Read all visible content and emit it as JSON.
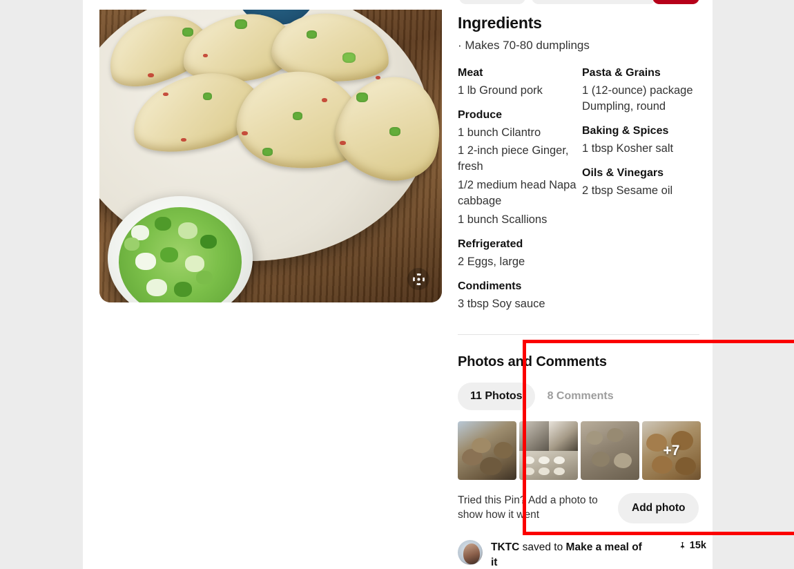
{
  "topbar": {
    "pill_one_label": "",
    "pill_two_label": "",
    "save_button_label": "",
    "accent_red": "#b60019"
  },
  "hero": {
    "alt": "Dumplings on a white plate with a bowl of chopped scallions on a wooden table",
    "visual_search_icon": "target-crosshair-icon"
  },
  "ingredients": {
    "title": "Ingredients",
    "servings": "· Makes 70-80 dumplings",
    "columns": [
      {
        "groups": [
          {
            "name": "Meat",
            "items": [
              "1 lb Ground pork"
            ]
          },
          {
            "name": "Produce",
            "items": [
              "1 bunch Cilantro",
              "1 2-inch piece Ginger, fresh",
              "1/2 medium head Napa cabbage",
              "1 bunch Scallions"
            ]
          },
          {
            "name": "Refrigerated",
            "items": [
              "2 Eggs, large"
            ]
          },
          {
            "name": "Condiments",
            "items": [
              "3 tbsp Soy sauce"
            ]
          }
        ]
      },
      {
        "groups": [
          {
            "name": "Pasta & Grains",
            "items": [
              "1 (12-ounce) package Dumpling, round"
            ]
          },
          {
            "name": "Baking & Spices",
            "items": [
              "1 tbsp Kosher salt"
            ]
          },
          {
            "name": "Oils & Vinegars",
            "items": [
              "2 tbsp Sesame oil"
            ]
          }
        ]
      }
    ]
  },
  "photos_and_comments": {
    "title": "Photos and Comments",
    "tabs": [
      {
        "label": "11 Photos",
        "active": true
      },
      {
        "label": "8 Comments",
        "active": false
      }
    ],
    "thumbnails": [
      {
        "name": "photo-thumbnail-1",
        "overlay": ""
      },
      {
        "name": "photo-thumbnail-2",
        "overlay": ""
      },
      {
        "name": "photo-thumbnail-3",
        "overlay": ""
      },
      {
        "name": "photo-thumbnail-4",
        "overlay": "+7"
      }
    ],
    "cta_text": "Tried this Pin? Add a photo to show how it went",
    "cta_button": "Add photo",
    "highlight_color": "#fb0000"
  },
  "saver": {
    "name": "TKTC",
    "action": " saved to ",
    "board": "Make a meal of it",
    "save_count": "15k",
    "pin_icon": "pushpin-icon"
  }
}
